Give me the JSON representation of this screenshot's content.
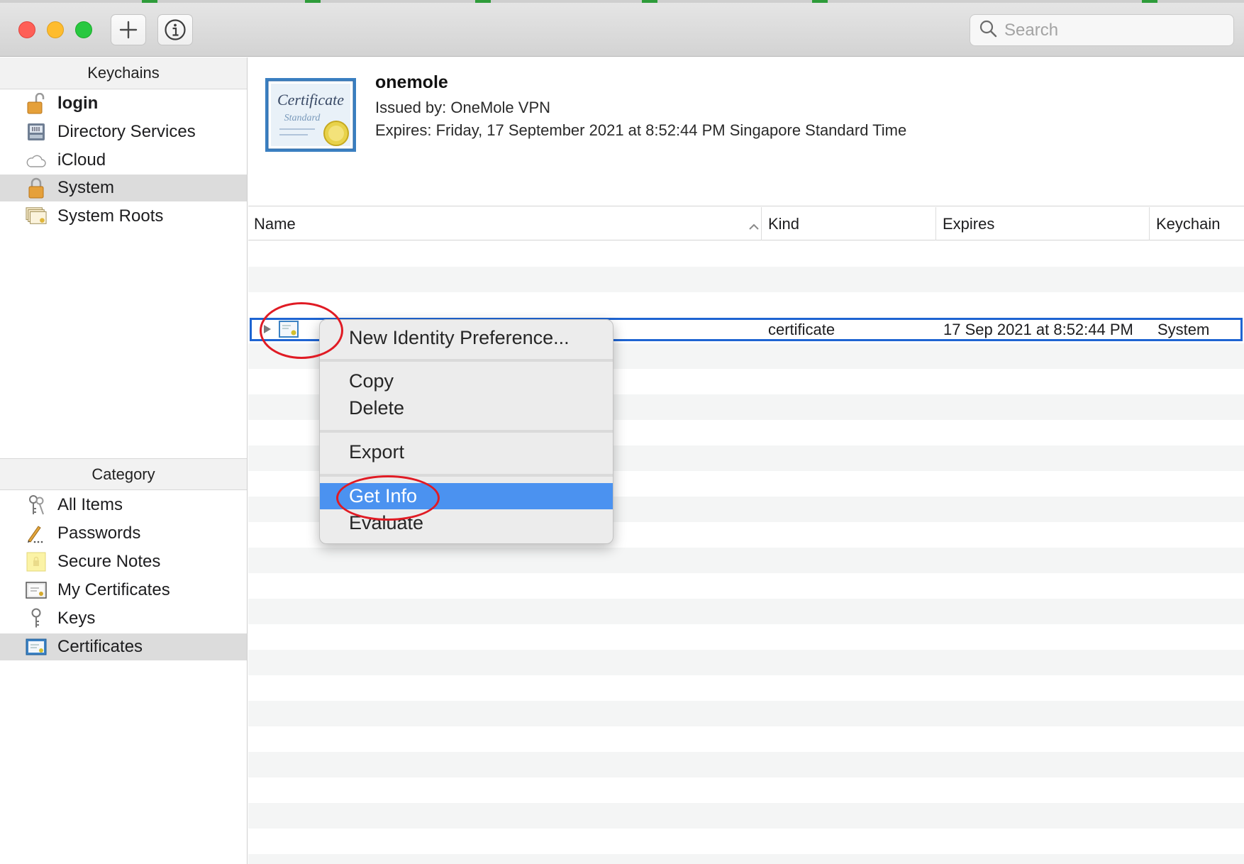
{
  "window": {
    "search_placeholder": "Search",
    "add_icon": "plus-icon",
    "info_icon": "info-icon"
  },
  "sidebar": {
    "keychains_header": "Keychains",
    "keychains": [
      {
        "label": "login",
        "icon": "unlocked-padlock-icon",
        "bold": true,
        "selected": false
      },
      {
        "label": "Directory Services",
        "icon": "directory-server-icon",
        "bold": false,
        "selected": false
      },
      {
        "label": "iCloud",
        "icon": "cloud-icon",
        "bold": false,
        "selected": false
      },
      {
        "label": "System",
        "icon": "locked-padlock-icon",
        "bold": false,
        "selected": true
      },
      {
        "label": "System Roots",
        "icon": "certificate-stack-icon",
        "bold": false,
        "selected": false
      }
    ],
    "category_header": "Category",
    "categories": [
      {
        "label": "All Items",
        "icon": "keys-icon",
        "selected": false
      },
      {
        "label": "Passwords",
        "icon": "pencil-icon",
        "selected": false
      },
      {
        "label": "Secure Notes",
        "icon": "note-icon",
        "selected": false
      },
      {
        "label": "My Certificates",
        "icon": "my-certificate-icon",
        "selected": false
      },
      {
        "label": "Keys",
        "icon": "key-icon",
        "selected": false
      },
      {
        "label": "Certificates",
        "icon": "certificate-icon",
        "selected": true
      }
    ]
  },
  "detail": {
    "title": "onemole",
    "issued_by": "Issued by: OneMole VPN",
    "expires": "Expires: Friday, 17 September 2021 at 8:52:44 PM Singapore Standard Time",
    "cert_icon_title": "Certificate",
    "cert_icon_subtitle": "Standard"
  },
  "table": {
    "columns": [
      "Name",
      "Kind",
      "Expires",
      "Keychain"
    ],
    "sort_column": "Name",
    "rows": [
      {
        "name": "",
        "kind": "certificate",
        "expires": "17 Sep 2021 at 8:52:44 PM",
        "keychain": "System",
        "selected": true
      }
    ]
  },
  "context_menu": {
    "items": [
      {
        "label": "New Identity Preference...",
        "highlighted": false
      },
      {
        "label": "Copy",
        "highlighted": false
      },
      {
        "label": "Delete",
        "highlighted": false
      },
      {
        "label": "Export",
        "highlighted": false
      },
      {
        "label": "Get Info",
        "highlighted": true
      },
      {
        "label": "Evaluate",
        "highlighted": false
      }
    ]
  },
  "colors": {
    "selection_border": "#1e64d2",
    "menu_highlight": "#4b92f0",
    "annotation_ring": "#e01b24",
    "sidebar_selected": "#dcdcdc"
  }
}
